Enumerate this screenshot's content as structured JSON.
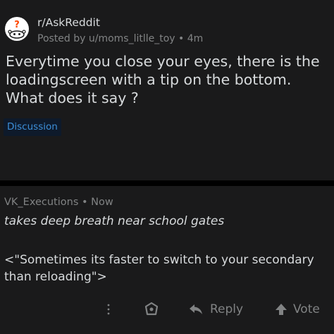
{
  "post": {
    "subreddit": "r/AskReddit",
    "posted_by": "Posted by u/moms_litlle_toy",
    "age": "4m",
    "separator": "•",
    "title": "Everytime you close your eyes, there is the loadingscreen with a tip on the bottom. What does it say ?",
    "flair": "Discussion",
    "avatar_icon": "askreddit-snoo-icon",
    "avatar_symbol": "?"
  },
  "comment": {
    "author": "VK_Executions",
    "separator": "•",
    "age": "Now",
    "line1": "takes deep breath near school gates",
    "line2": "<\"Sometimes its faster to switch to your secondary than reloading\">"
  },
  "actions": {
    "more_icon": "more-options-icon",
    "award_icon": "award-icon",
    "reply_label": "Reply",
    "vote_label": "Vote"
  },
  "colors": {
    "background": "#000000",
    "card": "#1a1a1b",
    "text": "#d7dadc",
    "muted": "#818384",
    "flair_text": "#3d8fd9",
    "flair_bg": "#0e1a2b"
  }
}
